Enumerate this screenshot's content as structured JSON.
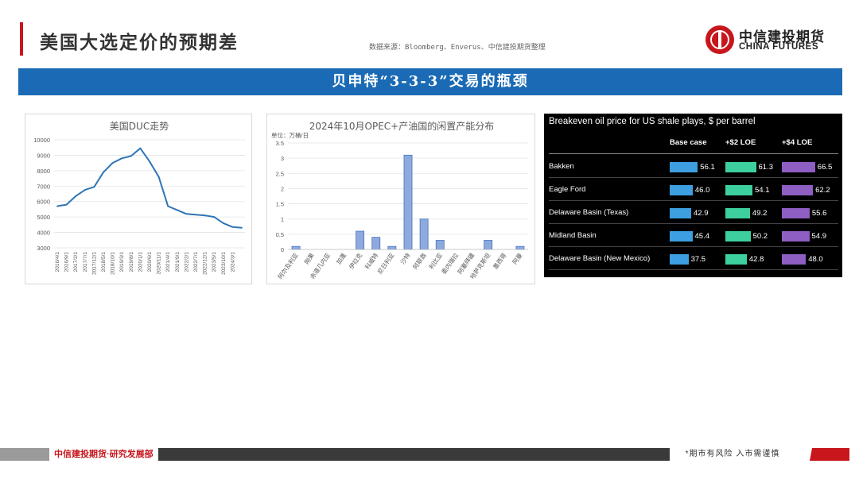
{
  "header": {
    "title": "美国大选定价的预期差",
    "source": "数据来源：Bloomberg、Enverus、中信建投期货整理",
    "logo_cn": "中信建投期货",
    "logo_en": "CHINA FUTURES"
  },
  "banner": {
    "text": "贝申特“3-3-3”交易的瓶颈"
  },
  "chart_data": [
    {
      "type": "line",
      "title": "美国DUC走势",
      "x": [
        "2016/4/1",
        "2016/9/1",
        "2017/2/1",
        "2017/7/1",
        "2017/12/1",
        "2018/5/1",
        "2018/10/1",
        "2019/3/1",
        "2019/8/1",
        "2020/1/1",
        "2020/6/1",
        "2020/11/1",
        "2021/4/1",
        "2021/9/1",
        "2022/2/1",
        "2022/7/1",
        "2022/12/1",
        "2023/5/1",
        "2023/10/1",
        "2024/3/1",
        "2024/8/1"
      ],
      "series": [
        {
          "values": [
            5700,
            5800,
            6350,
            6750,
            6950,
            7900,
            8500,
            8800,
            8950,
            9450,
            8600,
            7600,
            5700,
            5450,
            5200,
            5150,
            5100,
            5000,
            4600,
            4350,
            4300
          ]
        }
      ],
      "tick_labels": [
        "2016/4/1",
        "2016/9/1",
        "2017/2/1",
        "2017/7/1",
        "2017/12/1",
        "2018/5/1",
        "2018/10/1",
        "2019/3/1",
        "2019/8/1",
        "2020/1/1",
        "2020/6/1",
        "2020/11/1",
        "2021/4/1",
        "2021/9/1",
        "2022/2/1",
        "2022/7/1",
        "2022/12/1",
        "2023/5/1",
        "2023/10/1",
        "2024/3/1"
      ],
      "ylim": [
        3000,
        10000
      ],
      "yticks": [
        3000,
        4000,
        5000,
        6000,
        7000,
        8000,
        9000,
        10000
      ],
      "grid": true,
      "color": "#2e75b6"
    },
    {
      "type": "bar",
      "title": "2024年10月OPEC+产油国的闲置产能分布",
      "ylabel": "单位：万桶/日",
      "categories": [
        "阿尔及利亚",
        "刚果",
        "赤道几内亚",
        "加蓬",
        "伊拉克",
        "科威特",
        "尼日利亚",
        "沙特",
        "阿联酋",
        "利比亚",
        "委内瑞拉",
        "阿塞拜疆",
        "哈萨克斯坦",
        "墨西哥",
        "阿曼"
      ],
      "values": [
        0.1,
        0,
        0,
        0,
        0.6,
        0.4,
        0.1,
        3.1,
        1.0,
        0.3,
        0,
        0,
        0.3,
        0,
        0.1
      ],
      "ylim": [
        0,
        3.5
      ],
      "yticks": [
        0,
        0.5,
        1,
        1.5,
        2,
        2.5,
        3,
        3.5
      ],
      "grid": true,
      "color": "#8ea9db",
      "border": "#4472c4"
    }
  ],
  "table": {
    "title": "Breakeven oil price for US shale plays, $ per barrel",
    "columns": [
      "Base case",
      "+$2 LOE",
      "+$4 LOE"
    ],
    "colors": [
      "#3d9ee0",
      "#3ecf9f",
      "#8e5ec2"
    ],
    "max": 70,
    "rows": [
      {
        "label": "Bakken",
        "values": [
          56.1,
          61.3,
          66.5
        ]
      },
      {
        "label": "Eagle Ford",
        "values": [
          46.0,
          54.1,
          62.2
        ]
      },
      {
        "label": "Delaware Basin (Texas)",
        "values": [
          42.9,
          49.2,
          55.6
        ]
      },
      {
        "label": "Midland Basin",
        "values": [
          45.4,
          50.2,
          54.9
        ]
      },
      {
        "label": "Delaware Basin (New Mexico)",
        "values": [
          37.5,
          42.8,
          48.0
        ]
      }
    ],
    "value_labels": [
      [
        "56.1",
        "61.3",
        "66.5"
      ],
      [
        "46.0",
        "54.1",
        "62.2"
      ],
      [
        "42.9",
        "49.2",
        "55.6"
      ],
      [
        "45.4",
        "50.2",
        "54.9"
      ],
      [
        "37.5",
        "42.8",
        "48.0"
      ]
    ]
  },
  "footer": {
    "left": "中信建投期货·研究发展部",
    "right": "*期市有风险  入市需谨慎"
  }
}
